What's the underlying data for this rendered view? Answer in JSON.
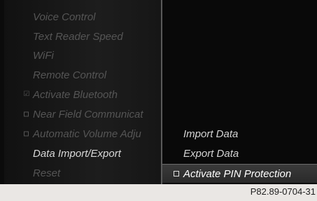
{
  "left_menu": {
    "items": [
      {
        "label": "Voice Control",
        "state": "dimmed"
      },
      {
        "label": "Text Reader Speed",
        "state": "dimmed"
      },
      {
        "label": "WiFi",
        "state": "dimmed"
      },
      {
        "label": "Remote Control",
        "state": "dimmed"
      },
      {
        "label": "Activate Bluetooth",
        "state": "dimmed",
        "mark": "☑"
      },
      {
        "label": "Near Field Communicat",
        "state": "dimmed",
        "mark": "box"
      },
      {
        "label": "Automatic Volume Adju",
        "state": "dimmed",
        "mark": "box"
      },
      {
        "label": "Data Import/Export",
        "state": "active"
      },
      {
        "label": "Reset",
        "state": "dimmed"
      }
    ]
  },
  "right_menu": {
    "items": [
      {
        "label": "Import Data"
      },
      {
        "label": "Export Data"
      },
      {
        "label": "Activate PIN Protection",
        "selected": true,
        "checkbox": "unchecked"
      }
    ]
  },
  "caption": "P82.89-0704-31",
  "colors": {
    "screen_bg": "#000000",
    "dimmed_text": "#555555",
    "active_text": "#d8d8d8",
    "selection_bar": "#333333",
    "page_bg": "#eae7e4"
  }
}
